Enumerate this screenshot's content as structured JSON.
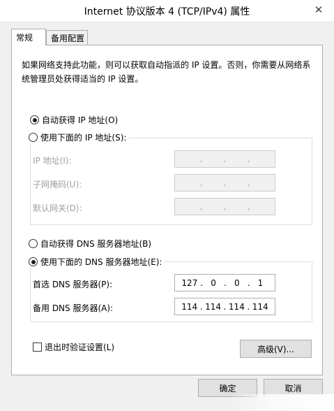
{
  "window": {
    "title": "Internet 协议版本 4 (TCP/IPv4) 属性",
    "close_glyph": "✕"
  },
  "tabs": [
    {
      "label": "常规",
      "active": true
    },
    {
      "label": "备用配置",
      "active": false
    }
  ],
  "description": "如果网络支持此功能，则可以获取自动指派的 IP 设置。否则，你需要从网络系统管理员处获得适当的 IP 设置。",
  "ip_section": {
    "auto_label": "自动获得 IP 地址(O)",
    "auto_checked": true,
    "manual_label": "使用下面的 IP 地址(S):",
    "manual_checked": false,
    "fields": [
      {
        "label": "IP 地址(I):",
        "octets": [
          "",
          "",
          "",
          ""
        ]
      },
      {
        "label": "子网掩码(U):",
        "octets": [
          "",
          "",
          "",
          ""
        ]
      },
      {
        "label": "默认网关(D):",
        "octets": [
          "",
          "",
          "",
          ""
        ]
      }
    ]
  },
  "dns_section": {
    "auto_label": "自动获得 DNS 服务器地址(B)",
    "auto_checked": false,
    "manual_label": "使用下面的 DNS 服务器地址(E):",
    "manual_checked": true,
    "fields": [
      {
        "label": "首选 DNS 服务器(P):",
        "octets": [
          "127",
          "0",
          "0",
          "1"
        ]
      },
      {
        "label": "备用 DNS 服务器(A):",
        "octets": [
          "114",
          "114",
          "114",
          "114"
        ]
      }
    ]
  },
  "validate_on_exit": {
    "label": "退出时验证设置(L)",
    "checked": false
  },
  "buttons": {
    "advanced": "高级(V)...",
    "ok": "确定",
    "cancel": "取消"
  },
  "separator": "."
}
